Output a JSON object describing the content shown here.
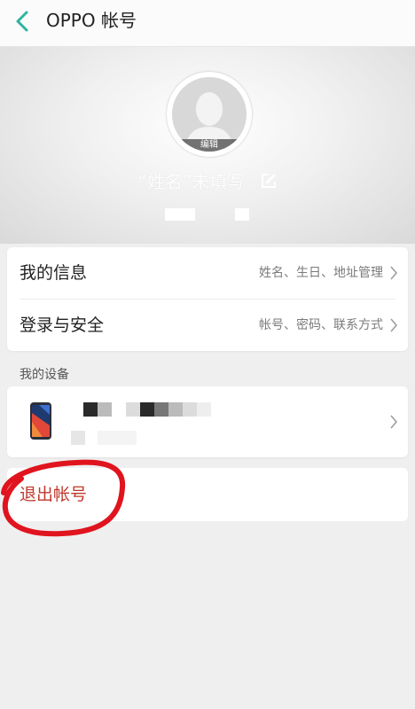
{
  "topbar": {
    "title": "OPPO 帐号"
  },
  "profile": {
    "name_text": "“姓名”未填写",
    "edit_label": "编辑"
  },
  "account_menu": [
    {
      "label": "我的信息",
      "detail": "姓名、生日、地址管理"
    },
    {
      "label": "登录与安全",
      "detail": "帐号、密码、联系方式"
    }
  ],
  "devices": {
    "section_label": "我的设备"
  },
  "logout": {
    "label": "退出帐号"
  },
  "colors": {
    "accent": "#2fb3a0",
    "danger": "#c0392b",
    "annotation": "#e0141e"
  }
}
